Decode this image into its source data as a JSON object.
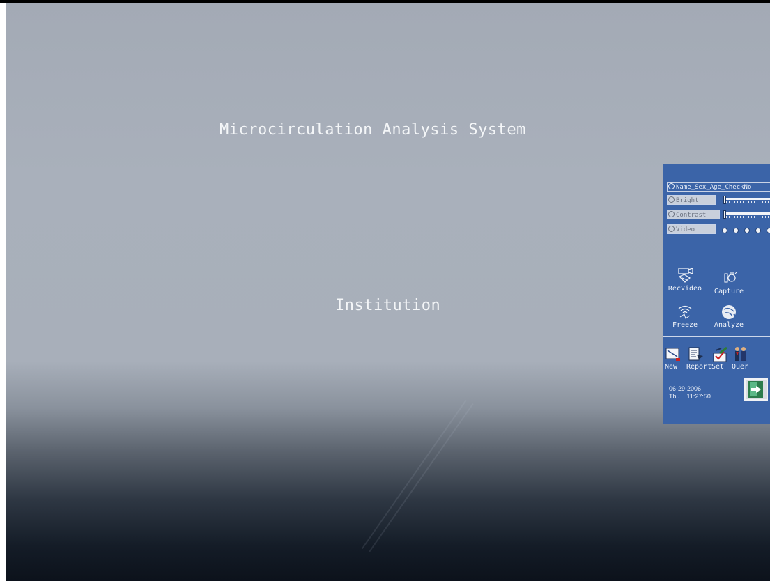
{
  "screen": {
    "title": "Microcirculation Analysis System",
    "institution": "Institution"
  },
  "panel": {
    "fields": {
      "name": "Name_Sex_Age_CheckNo",
      "bright": "Bright",
      "contrast": "Contrast",
      "video": "Video"
    },
    "tools": [
      {
        "label": "RecVideo",
        "icon": "video-camera-icon"
      },
      {
        "label": "Capture",
        "icon": "camera-icon"
      },
      {
        "label": "Freeze",
        "icon": "freeze-icon"
      },
      {
        "label": "Analyze",
        "icon": "analyze-icon"
      }
    ],
    "actions": [
      {
        "label": "New",
        "icon": "new-document-icon"
      },
      {
        "label": "Report",
        "icon": "report-icon"
      },
      {
        "label": "Set",
        "icon": "settings-icon"
      },
      {
        "label": "Quer",
        "icon": "query-people-icon"
      }
    ],
    "date": "06-29-2006",
    "day": "Thu",
    "time": "11:27:50",
    "exit_icon": "exit-door-icon",
    "colors": {
      "panel": "#3b64a8",
      "text": "#eef2f9"
    }
  }
}
